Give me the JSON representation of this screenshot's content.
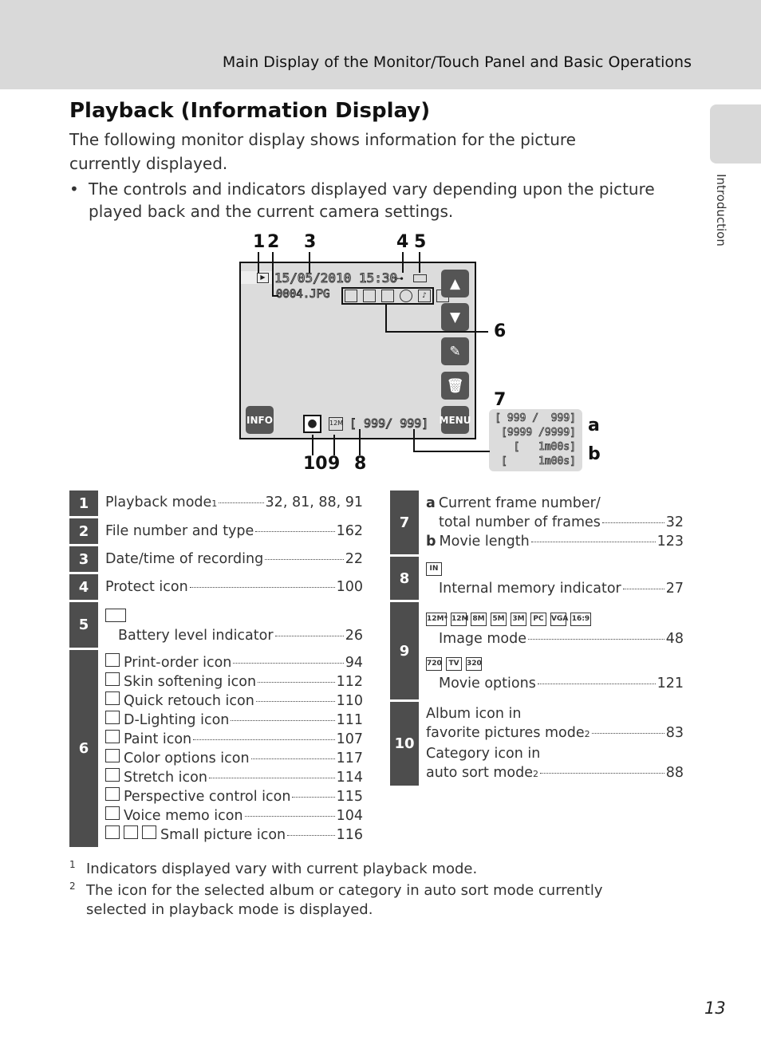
{
  "header": {
    "title": "Main Display of the Monitor/Touch Panel and Basic Operations"
  },
  "side_tab": {
    "label": "Introduction"
  },
  "title": "Playback (Information Display)",
  "intro": "The following monitor display shows information for the picture currently displayed.",
  "bullet": "The controls and indicators displayed vary depending upon the picture played back and the current camera settings.",
  "diagram": {
    "date_time": "15/05/2010  15:30",
    "file_name": "0004.JPG",
    "counter": "[ 999/  999]",
    "info_button": "INFO",
    "menu_button": "MENU",
    "callouts": [
      "1",
      "2",
      "3",
      "4",
      "5",
      "6",
      "7",
      "8",
      "9",
      "10",
      "a",
      "b"
    ],
    "panel_lines": [
      "[ 999 /  999]",
      "[9999 /9999]",
      "[   1m00s]",
      "[     1m00s]"
    ],
    "icons": [
      "playback-icon",
      "protect-icon",
      "battery-icon",
      "print-order-icon",
      "skin-softening-icon",
      "d-lighting-icon",
      "color-options-icon",
      "voice-memo-icon",
      "small-picture-icon",
      "album-icon",
      "image-mode-icon",
      "internal-memory-icon",
      "up-arrow-icon",
      "down-arrow-icon",
      "edit-icon",
      "delete-icon"
    ]
  },
  "left_table": [
    {
      "num": "1",
      "items": [
        {
          "label": "Playback mode",
          "sup": "1",
          "page": "32, 81, 88, 91"
        }
      ]
    },
    {
      "num": "2",
      "items": [
        {
          "label": "File number and type",
          "page": "162"
        }
      ]
    },
    {
      "num": "3",
      "items": [
        {
          "label": "Date/time of recording",
          "page": "22"
        }
      ]
    },
    {
      "num": "4",
      "items": [
        {
          "label": "Protect icon",
          "page": "100"
        }
      ]
    },
    {
      "num": "5",
      "iconrow": [
        "battery"
      ],
      "items": [
        {
          "label": "Battery level indicator",
          "page": "26",
          "indent": true
        }
      ]
    },
    {
      "num": "6",
      "items": [
        {
          "icons": [
            "print-order"
          ],
          "label": "Print-order icon",
          "page": "94"
        },
        {
          "icons": [
            "skin-softening"
          ],
          "label": "Skin softening icon",
          "page": "112"
        },
        {
          "icons": [
            "quick-retouch"
          ],
          "label": "Quick retouch icon",
          "page": "110"
        },
        {
          "icons": [
            "d-lighting"
          ],
          "label": "D-Lighting icon",
          "page": "111"
        },
        {
          "icons": [
            "paint"
          ],
          "label": "Paint icon",
          "page": "107"
        },
        {
          "icons": [
            "color-options"
          ],
          "label": "Color options icon",
          "page": "117"
        },
        {
          "icons": [
            "stretch"
          ],
          "label": "Stretch icon",
          "page": "114"
        },
        {
          "icons": [
            "perspective"
          ],
          "label": "Perspective control icon",
          "page": "115"
        },
        {
          "icons": [
            "voice-memo"
          ],
          "label": "Voice memo icon",
          "page": "104"
        },
        {
          "icons": [
            "small-picture-1",
            "small-picture-2",
            "small-picture-3"
          ],
          "label": "Small picture icon",
          "page": "116"
        }
      ]
    }
  ],
  "right_table": [
    {
      "num": "7",
      "items": [
        {
          "prefix": "a",
          "label": "Current frame number/"
        },
        {
          "label": "total number of frames",
          "page": "32",
          "indent": true
        },
        {
          "prefix": "b",
          "label": "Movie length",
          "page": "123"
        }
      ]
    },
    {
      "num": "8",
      "iconrow": [
        "IN"
      ],
      "items": [
        {
          "label": "Internal memory indicator",
          "page": "27",
          "indent": true
        }
      ]
    },
    {
      "num": "9",
      "iconrow": [
        "12M*",
        "12M",
        "8M",
        "5M",
        "3M",
        "PC",
        "VGA",
        "16:9"
      ],
      "items": [
        {
          "label": "Image mode",
          "page": "48",
          "indent": true
        }
      ],
      "iconrow2": [
        "720",
        "TV",
        "320"
      ],
      "items2": [
        {
          "label": "Movie options",
          "page": "121",
          "indent": true
        }
      ]
    },
    {
      "num": "10",
      "items": [
        {
          "label": "Album icon in"
        },
        {
          "label": "favorite pictures mode",
          "sup": "2",
          "page": "83"
        },
        {
          "label": "Category icon in"
        },
        {
          "label": "auto sort mode",
          "sup": "2",
          "page": "88"
        }
      ]
    }
  ],
  "footnotes": [
    {
      "mark": "1",
      "text": "Indicators displayed vary with current playback mode."
    },
    {
      "mark": "2",
      "text": "The icon for the selected album or category in auto sort mode currently selected in playback mode is displayed."
    }
  ],
  "page_number": "13"
}
